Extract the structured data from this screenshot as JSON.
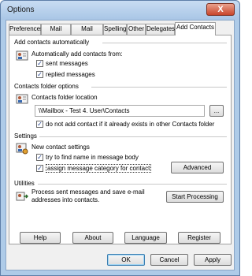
{
  "window": {
    "title": "Options",
    "close_symbol": "X"
  },
  "tabs": [
    "Preferences",
    "Mail Setup",
    "Mail Format",
    "Spelling",
    "Other",
    "Delegates",
    "Add Contacts"
  ],
  "add_contacts": {
    "section_title": "Add contacts automatically",
    "auto_add_label": "Automatically add contacts from:",
    "sent_messages": {
      "label": "sent messages",
      "checked": true
    },
    "replied_messages": {
      "label": "replied messages",
      "checked": true
    }
  },
  "contacts_folder": {
    "section_title": "Contacts folder options",
    "location_label": "Contacts folder location",
    "path": "\\\\Mailbox - Test 4. User\\Contacts",
    "browse_label": "...",
    "no_duplicate": {
      "label": "do not add contact if it already exists in other Contacts folder",
      "checked": true
    }
  },
  "settings": {
    "section_title": "Settings",
    "new_contact_label": "New contact settings",
    "try_find_name": {
      "label": "try to find name in message body",
      "checked": true
    },
    "assign_category": {
      "label": "assign message category for contact",
      "checked": true
    },
    "advanced_label": "Advanced"
  },
  "utilities": {
    "section_title": "Utilities",
    "description": "Process sent messages and save e-mail addresses into contacts.",
    "start_label": "Start Processing"
  },
  "bottom_buttons": {
    "help": "Help",
    "about": "About",
    "language": "Language",
    "register": "Register"
  },
  "dialog_buttons": {
    "ok": "OK",
    "cancel": "Cancel",
    "apply": "Apply"
  },
  "check_mark": "✓"
}
